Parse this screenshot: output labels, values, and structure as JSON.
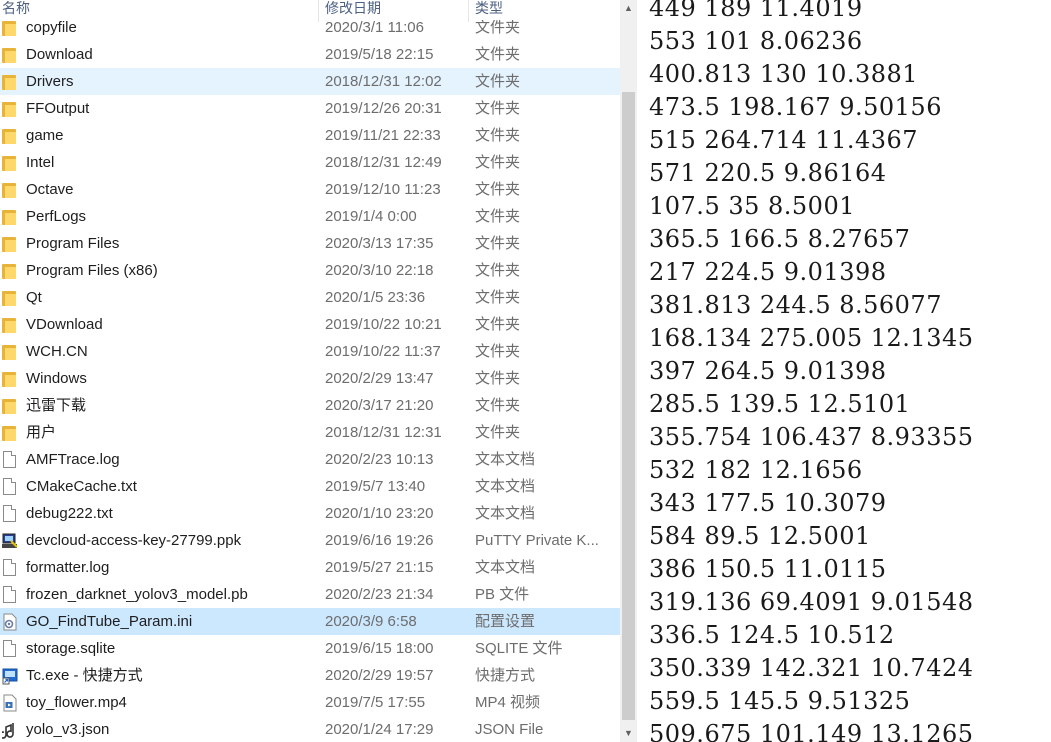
{
  "columns": {
    "name": "名称",
    "date": "修改日期",
    "type": "类型"
  },
  "files": [
    {
      "name": "copyfile",
      "date": "2020/3/1 11:06",
      "type": "文件夹",
      "icon": "folder-icon"
    },
    {
      "name": "Download",
      "date": "2019/5/18 22:15",
      "type": "文件夹",
      "icon": "folder-icon"
    },
    {
      "name": "Drivers",
      "date": "2018/12/31 12:02",
      "type": "文件夹",
      "icon": "folder-icon",
      "state": "hover"
    },
    {
      "name": "FFOutput",
      "date": "2019/12/26 20:31",
      "type": "文件夹",
      "icon": "folder-icon"
    },
    {
      "name": "game",
      "date": "2019/11/21 22:33",
      "type": "文件夹",
      "icon": "folder-icon"
    },
    {
      "name": "Intel",
      "date": "2018/12/31 12:49",
      "type": "文件夹",
      "icon": "folder-icon"
    },
    {
      "name": "Octave",
      "date": "2019/12/10 11:23",
      "type": "文件夹",
      "icon": "folder-icon"
    },
    {
      "name": "PerfLogs",
      "date": "2019/1/4 0:00",
      "type": "文件夹",
      "icon": "folder-icon"
    },
    {
      "name": "Program Files",
      "date": "2020/3/13 17:35",
      "type": "文件夹",
      "icon": "folder-icon"
    },
    {
      "name": "Program Files (x86)",
      "date": "2020/3/10 22:18",
      "type": "文件夹",
      "icon": "folder-icon"
    },
    {
      "name": "Qt",
      "date": "2020/1/5 23:36",
      "type": "文件夹",
      "icon": "folder-icon"
    },
    {
      "name": "VDownload",
      "date": "2019/10/22 10:21",
      "type": "文件夹",
      "icon": "folder-icon"
    },
    {
      "name": "WCH.CN",
      "date": "2019/10/22 11:37",
      "type": "文件夹",
      "icon": "folder-icon"
    },
    {
      "name": "Windows",
      "date": "2020/2/29 13:47",
      "type": "文件夹",
      "icon": "folder-icon"
    },
    {
      "name": "迅雷下载",
      "date": "2020/3/17 21:20",
      "type": "文件夹",
      "icon": "folder-icon"
    },
    {
      "name": "用户",
      "date": "2018/12/31 12:31",
      "type": "文件夹",
      "icon": "folder-icon"
    },
    {
      "name": "AMFTrace.log",
      "date": "2020/2/23 10:13",
      "type": "文本文档",
      "icon": "text-file-icon"
    },
    {
      "name": "CMakeCache.txt",
      "date": "2019/5/7 13:40",
      "type": "文本文档",
      "icon": "text-file-icon"
    },
    {
      "name": "debug222.txt",
      "date": "2020/1/10 23:20",
      "type": "文本文档",
      "icon": "text-file-icon"
    },
    {
      "name": "devcloud-access-key-27799.ppk",
      "date": "2019/6/16 19:26",
      "type": "PuTTY Private K...",
      "icon": "putty-key-icon"
    },
    {
      "name": "formatter.log",
      "date": "2019/5/27 21:15",
      "type": "文本文档",
      "icon": "text-file-icon"
    },
    {
      "name": "frozen_darknet_yolov3_model.pb",
      "date": "2020/2/23 21:34",
      "type": "PB 文件",
      "icon": "blank-file-icon"
    },
    {
      "name": "GO_FindTube_Param.ini",
      "date": "2020/3/9 6:58",
      "type": "配置设置",
      "icon": "config-file-icon",
      "state": "selected"
    },
    {
      "name": "storage.sqlite",
      "date": "2019/6/15 18:00",
      "type": "SQLITE 文件",
      "icon": "blank-file-icon"
    },
    {
      "name": "Tc.exe - 快捷方式",
      "date": "2020/2/29 19:57",
      "type": "快捷方式",
      "icon": "shortcut-icon"
    },
    {
      "name": "toy_flower.mp4",
      "date": "2019/7/5 17:55",
      "type": "MP4 视频",
      "icon": "video-file-icon"
    },
    {
      "name": "yolo_v3.json",
      "date": "2020/1/24 17:29",
      "type": "JSON File",
      "icon": "json-file-icon"
    }
  ],
  "numbers": [
    "449 189 11.4019",
    "553 101 8.06236",
    "400.813 130 10.3881",
    "473.5 198.167 9.50156",
    "515 264.714 11.4367",
    "571 220.5 9.86164",
    "107.5 35 8.5001",
    "365.5 166.5 8.27657",
    "217 224.5 9.01398",
    "381.813 244.5 8.56077",
    "168.134 275.005 12.1345",
    "397 264.5 9.01398",
    "285.5 139.5 12.5101",
    "355.754 106.437 8.93355",
    "532 182 12.1656",
    "343 177.5 10.3079",
    "584 89.5 12.5001",
    "386 150.5 11.0115",
    "319.136 69.4091 9.01548",
    "336.5 124.5 10.512",
    "350.339 142.321 10.7424",
    "559.5 145.5 9.51325",
    "509.675 101.149 13.1265"
  ]
}
